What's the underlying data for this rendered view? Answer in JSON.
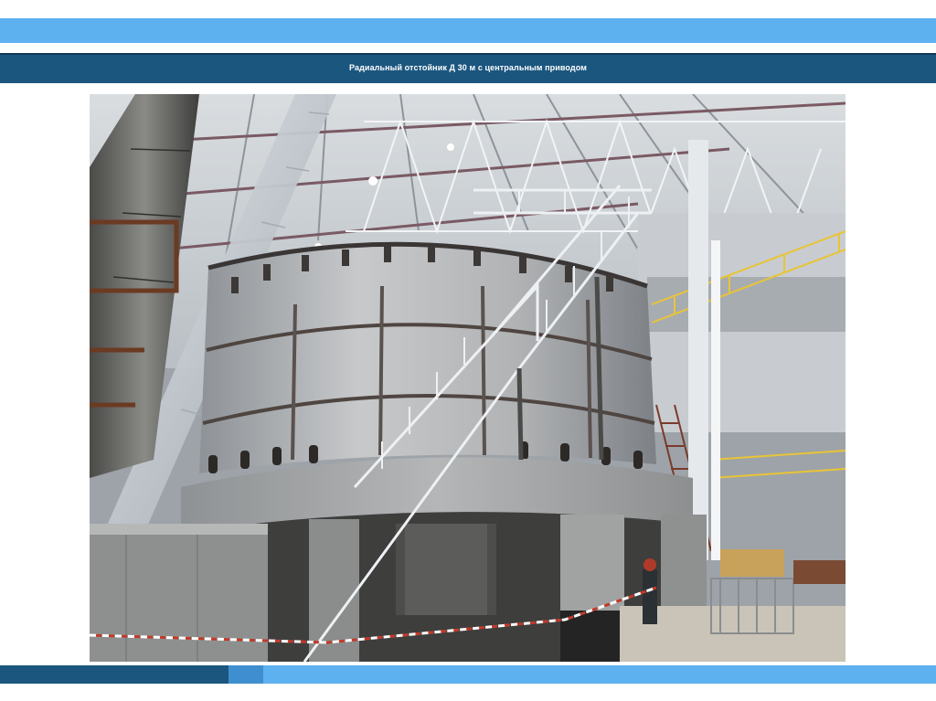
{
  "slide": {
    "title": "Радиальный отстойник Д 30 м с центральным приводом"
  },
  "photo": {
    "subject": "radial-settling-tank-photo"
  },
  "colors": {
    "band_light": "#5db1ee",
    "band_dark": "#1b567f",
    "band_mid": "#3f8fd0"
  }
}
